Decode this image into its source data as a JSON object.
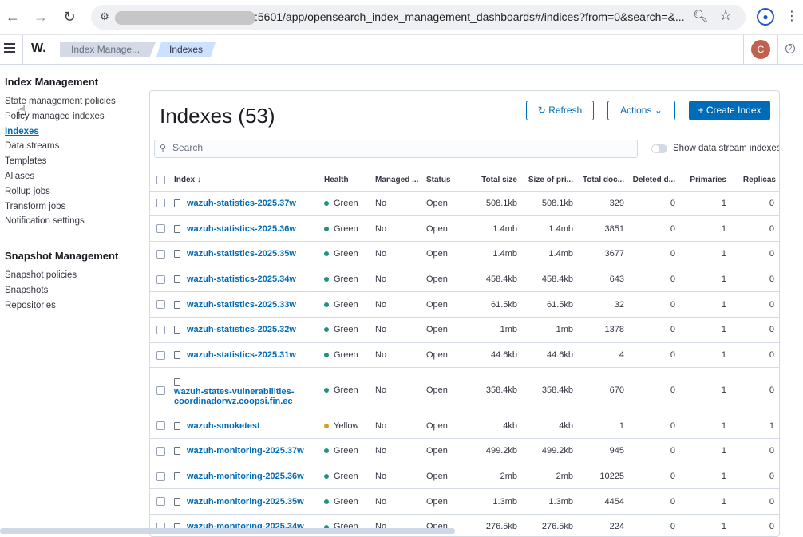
{
  "browser": {
    "url": ":5601/app/opensearch_index_management_dashboards#/indices?from=0&search=&...",
    "profile_letter": ""
  },
  "header": {
    "logo": "W.",
    "breadcrumbs": [
      "Index Manage...",
      "Indexes"
    ],
    "avatar_letter": "C",
    "help_label": "?"
  },
  "sidebar": {
    "section1_title": "Index Management",
    "items1": [
      {
        "label": "State management policies",
        "active": false
      },
      {
        "label": "Policy managed indexes",
        "active": false
      },
      {
        "label": "Indexes",
        "active": true
      },
      {
        "label": "Data streams",
        "active": false
      },
      {
        "label": "Templates",
        "active": false
      },
      {
        "label": "Aliases",
        "active": false
      },
      {
        "label": "Rollup jobs",
        "active": false
      },
      {
        "label": "Transform jobs",
        "active": false
      },
      {
        "label": "Notification settings",
        "active": false
      }
    ],
    "section2_title": "Snapshot Management",
    "items2": [
      {
        "label": "Snapshot policies"
      },
      {
        "label": "Snapshots"
      },
      {
        "label": "Repositories"
      }
    ]
  },
  "main": {
    "title": "Indexes (53)",
    "refresh_label": "Refresh",
    "actions_label": "Actions",
    "create_label": "Create Index",
    "search_placeholder": "Search",
    "toggle_label": "Show data stream indexes",
    "columns": [
      "Index",
      "Health",
      "Managed ...",
      "Status",
      "Total size",
      "Size of pri...",
      "Total doc...",
      "Deleted d...",
      "Primaries",
      "Replicas"
    ],
    "rows": [
      {
        "name": "wazuh-statistics-2025.37w",
        "health": "Green",
        "managed": "No",
        "status": "Open",
        "total_size": "508.1kb",
        "primary_size": "508.1kb",
        "docs": "329",
        "deleted": "0",
        "primaries": "1",
        "replicas": "0"
      },
      {
        "name": "wazuh-statistics-2025.36w",
        "health": "Green",
        "managed": "No",
        "status": "Open",
        "total_size": "1.4mb",
        "primary_size": "1.4mb",
        "docs": "3851",
        "deleted": "0",
        "primaries": "1",
        "replicas": "0"
      },
      {
        "name": "wazuh-statistics-2025.35w",
        "health": "Green",
        "managed": "No",
        "status": "Open",
        "total_size": "1.4mb",
        "primary_size": "1.4mb",
        "docs": "3677",
        "deleted": "0",
        "primaries": "1",
        "replicas": "0"
      },
      {
        "name": "wazuh-statistics-2025.34w",
        "health": "Green",
        "managed": "No",
        "status": "Open",
        "total_size": "458.4kb",
        "primary_size": "458.4kb",
        "docs": "643",
        "deleted": "0",
        "primaries": "1",
        "replicas": "0"
      },
      {
        "name": "wazuh-statistics-2025.33w",
        "health": "Green",
        "managed": "No",
        "status": "Open",
        "total_size": "61.5kb",
        "primary_size": "61.5kb",
        "docs": "32",
        "deleted": "0",
        "primaries": "1",
        "replicas": "0"
      },
      {
        "name": "wazuh-statistics-2025.32w",
        "health": "Green",
        "managed": "No",
        "status": "Open",
        "total_size": "1mb",
        "primary_size": "1mb",
        "docs": "1378",
        "deleted": "0",
        "primaries": "1",
        "replicas": "0"
      },
      {
        "name": "wazuh-statistics-2025.31w",
        "health": "Green",
        "managed": "No",
        "status": "Open",
        "total_size": "44.6kb",
        "primary_size": "44.6kb",
        "docs": "4",
        "deleted": "0",
        "primaries": "1",
        "replicas": "0"
      },
      {
        "name": "wazuh-states-vulnerabilities-coordinadorwz.coopsi.fin.ec",
        "health": "Green",
        "managed": "No",
        "status": "Open",
        "total_size": "358.4kb",
        "primary_size": "358.4kb",
        "docs": "670",
        "deleted": "0",
        "primaries": "1",
        "replicas": "0",
        "tall": true
      },
      {
        "name": "wazuh-smoketest",
        "health": "Yellow",
        "managed": "No",
        "status": "Open",
        "total_size": "4kb",
        "primary_size": "4kb",
        "docs": "1",
        "deleted": "0",
        "primaries": "1",
        "replicas": "1"
      },
      {
        "name": "wazuh-monitoring-2025.37w",
        "health": "Green",
        "managed": "No",
        "status": "Open",
        "total_size": "499.2kb",
        "primary_size": "499.2kb",
        "docs": "945",
        "deleted": "0",
        "primaries": "1",
        "replicas": "0"
      },
      {
        "name": "wazuh-monitoring-2025.36w",
        "health": "Green",
        "managed": "No",
        "status": "Open",
        "total_size": "2mb",
        "primary_size": "2mb",
        "docs": "10225",
        "deleted": "0",
        "primaries": "1",
        "replicas": "0"
      },
      {
        "name": "wazuh-monitoring-2025.35w",
        "health": "Green",
        "managed": "No",
        "status": "Open",
        "total_size": "1.3mb",
        "primary_size": "1.3mb",
        "docs": "4454",
        "deleted": "0",
        "primaries": "1",
        "replicas": "0"
      },
      {
        "name": "wazuh-monitoring-2025.34w",
        "health": "Green",
        "managed": "No",
        "status": "Open",
        "total_size": "276.5kb",
        "primary_size": "276.5kb",
        "docs": "224",
        "deleted": "0",
        "primaries": "1",
        "replicas": "0"
      }
    ]
  },
  "colors": {
    "green": "#209280",
    "yellow": "#d6a01f",
    "link": "#006bb8"
  }
}
